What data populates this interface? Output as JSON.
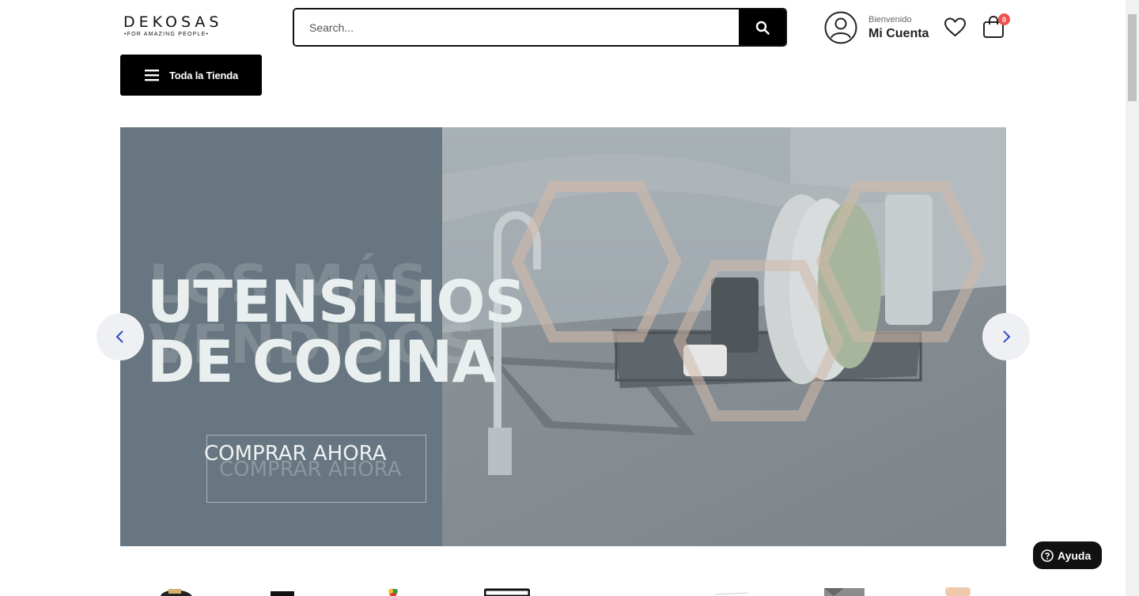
{
  "header": {
    "logo": {
      "name": "DEKOSAS",
      "tagline": "•FOR AMAZING PEOPLE•"
    },
    "search": {
      "placeholder": "Search...",
      "value": ""
    },
    "account": {
      "welcome": "Bienvenido",
      "label": "Mi Cuenta"
    },
    "cart": {
      "count": "0"
    },
    "store_button": {
      "label": "Toda la Tienda"
    }
  },
  "hero": {
    "title_line1": "UTENSILIOS",
    "title_line2": "DE COCINA",
    "ghost_line1": "LOS MÁS",
    "ghost_line2": "VENDIDOS",
    "cta_label": "COMPRAR AHORA"
  },
  "help": {
    "label": "Ayuda"
  },
  "icons": {
    "search": "search-icon",
    "account": "user-circle-icon",
    "wishlist": "heart-icon",
    "cart": "shopping-bag-icon",
    "menu": "hamburger-icon",
    "prev": "chevron-left-icon",
    "next": "chevron-right-icon",
    "help": "question-circle-icon"
  },
  "colors": {
    "accent": "#000000",
    "badge": "#f05050",
    "hero_panel": "#677680",
    "arrow_chevron": "#2d48c7"
  }
}
